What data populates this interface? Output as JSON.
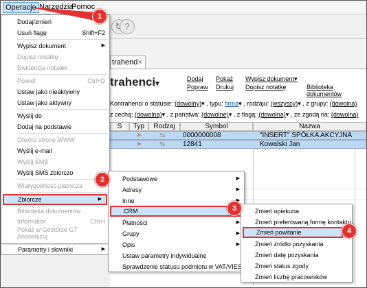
{
  "menubar": {
    "operacje": "Operacje",
    "narzedzia": "Narzędzia",
    "pomoc": "Pomoc"
  },
  "tab": {
    "label": "trahend",
    "close": "×"
  },
  "page": {
    "title": "trahenci",
    "title_suffix": "▾"
  },
  "links": {
    "dodaj": "Dodaj",
    "pokaz": "Pokaż",
    "wypisz": "Wypisz dokument",
    "wypisz_arrow": "▾",
    "popraw": "Popraw",
    "drukuj": "Drukuj",
    "dopisz": "Dopisz notatkę",
    "biblioteka": "Biblioteka dokumentów"
  },
  "filters": {
    "l1_a": "Kontrahenci o statusie:",
    "l1_a_val": "(dowolny)",
    "l1_b": ", typu:",
    "l1_b_val": "firma",
    "l1_c": ", rodzaju:",
    "l1_c_val": "(wszyscy)",
    "l1_d": ", z grupy:",
    "l1_d_val": "(dowolna)",
    "l2_a": "z cechą:",
    "l2_a_val": "(dowolna)",
    "l2_b": ", z państwa:",
    "l2_b_val": "(dowolne)",
    "l2_c": ", z flagą:",
    "l2_c_val": "(dowolna)",
    "l2_d": ", ze zgodą na:",
    "l2_d_val": "(dowolna)"
  },
  "grid": {
    "headers": [
      "S",
      "Typ",
      "Rodzaj",
      "Symbol",
      "Nazwa"
    ],
    "rows": [
      {
        "symbol": "0000000008",
        "nazwa": "\"INSERT\" SPÓŁKA AKCYJNA"
      },
      {
        "symbol": "12841",
        "nazwa": "Kowalski Jan"
      }
    ]
  },
  "menu": {
    "items": [
      {
        "label": "Dodaj/zmień"
      },
      {
        "label": "Usuń flagę",
        "shortcut": "Shift+F2"
      },
      {
        "label": "Wypisz dokument"
      },
      {
        "label": "Dopisz notatkę"
      },
      {
        "label": "Ewidencja notatek"
      },
      {
        "label": "Powiel",
        "shortcut": "Ctrl+D"
      },
      {
        "label": "Ustaw jako nieaktywny"
      },
      {
        "label": "Ustaw jako aktywny"
      },
      {
        "label": "Wyślij do"
      },
      {
        "label": "Dodaj na podstawie"
      },
      {
        "label": "Otwórz stronę WWW"
      },
      {
        "label": "Wyślij e-mail"
      },
      {
        "label": "Wyślij SMS"
      },
      {
        "label": "Wyślij SMS zbiorczo"
      },
      {
        "label": "Wiarygodność płatnicza"
      },
      {
        "label": "Zbiorcze"
      },
      {
        "label": "Biblioteka dokumentów"
      },
      {
        "label": "Informator",
        "shortcut": "Ctrl+I"
      },
      {
        "label": "Pokaż w Gestorze GT"
      },
      {
        "label": "Anonimizuj"
      },
      {
        "label": "Parametry i słowniki"
      }
    ]
  },
  "sub1": {
    "items": [
      {
        "label": "Podstawowe"
      },
      {
        "label": "Adresy"
      },
      {
        "label": "Inne"
      },
      {
        "label": "CRM"
      },
      {
        "label": "Płatności"
      },
      {
        "label": "Grupy"
      },
      {
        "label": "Opis"
      },
      {
        "label": "Ustaw parametry indywidualne"
      },
      {
        "label": "Sprawdzenie statusu podmiotu w VAT/VIES"
      }
    ]
  },
  "sub2": {
    "items": [
      {
        "label": "Zmień opiekuna"
      },
      {
        "label": "Zmień preferowaną formę kontaktu"
      },
      {
        "label": "Zmień powitanie"
      },
      {
        "label": "Zmień źródło pozyskania"
      },
      {
        "label": "Zmień datę pozyskania"
      },
      {
        "label": "Zmień status zgody"
      },
      {
        "label": "Zmień liczbę pracowników"
      }
    ]
  },
  "badges": [
    "1",
    "2",
    "3",
    "4"
  ],
  "colors": {
    "highlight": "#cce4f7",
    "annotation_red": "#e53030",
    "selected_row": "#bcd9f1"
  }
}
